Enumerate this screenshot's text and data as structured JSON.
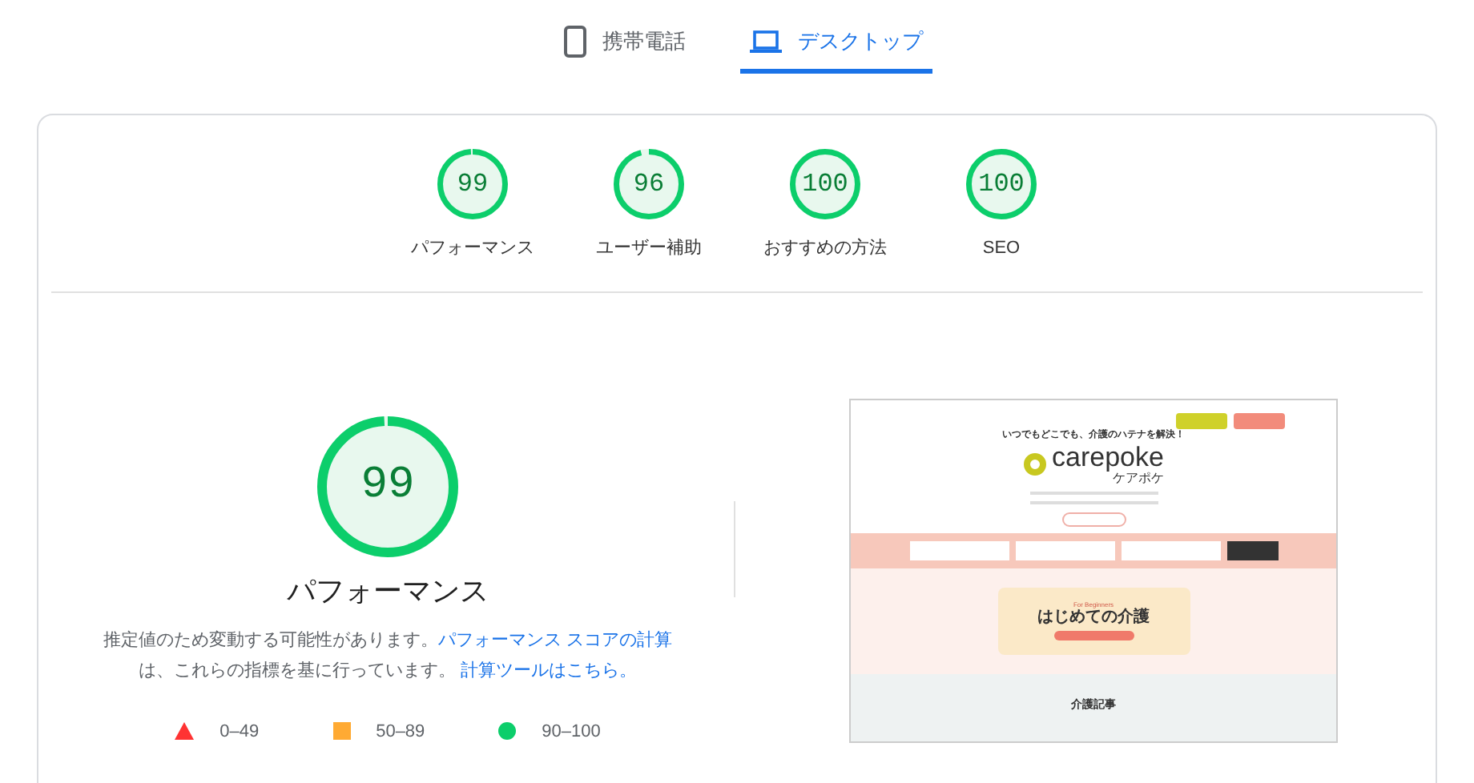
{
  "tabs": [
    {
      "kind": "phone",
      "label": "携帯電話",
      "selected": false
    },
    {
      "kind": "laptop",
      "label": "デスクトップ",
      "selected": true
    }
  ],
  "gauges": [
    {
      "score": "99",
      "label": "パフォーマンス",
      "level": 0.99
    },
    {
      "score": "96",
      "label": "ユーザー補助",
      "level": 0.96
    },
    {
      "score": "100",
      "label": "おすすめの方法",
      "level": 1
    },
    {
      "score": "100",
      "label": "SEO",
      "level": 1
    }
  ],
  "performance": {
    "score": "99",
    "level": 0.99,
    "title": "パフォーマンス",
    "description_1": "推定値のため変動する可能性があります。",
    "link_1": "パフォーマンス スコアの計算",
    "description_2": "は、これらの指標を基に行っています。",
    "link_2": "計算ツールはこちら。",
    "legend": [
      {
        "kind": "triangle",
        "label": "0–49",
        "color": "#ff3333"
      },
      {
        "kind": "square",
        "label": "50–89",
        "color": "#ffaa33"
      },
      {
        "kind": "circle",
        "label": "90–100",
        "color": "#0cce6b"
      }
    ]
  },
  "preview": {
    "tagline": "いつでもどこでも、介護のハテナを解決！",
    "logo": "carepoke",
    "logo_sub": "ケアポケ",
    "banner_sub": "For Beginners",
    "banner_title": "はじめての介護",
    "section": "介護記事"
  }
}
